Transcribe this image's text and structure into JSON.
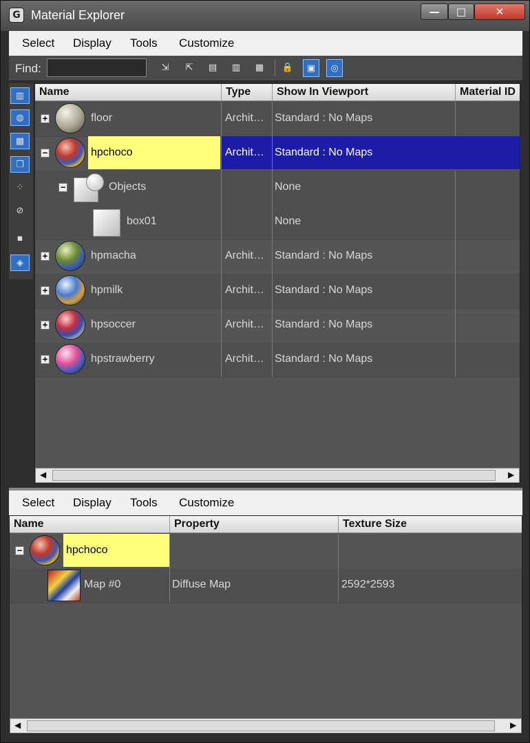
{
  "window": {
    "title": "Material Explorer",
    "icon": "app-logo-icon",
    "min": "—",
    "max": "□",
    "close": "✕"
  },
  "menu": [
    "Select",
    "Display",
    "Tools",
    "Customize"
  ],
  "find": {
    "label": "Find:",
    "value": ""
  },
  "materials_grid": {
    "columns": [
      "Name",
      "Type",
      "Show In Viewport",
      "Material ID"
    ],
    "rows": [
      {
        "name": "floor",
        "type": "Archit…",
        "viewport": "Standard : No Maps"
      },
      {
        "name": "hpchoco",
        "type": "Archit…",
        "viewport": "Standard : No Maps"
      },
      {
        "name": "Objects",
        "type": "",
        "viewport": "None"
      },
      {
        "name": "box01",
        "type": "",
        "viewport": "None"
      },
      {
        "name": "hpmacha",
        "type": "Archit…",
        "viewport": "Standard : No Maps"
      },
      {
        "name": "hpmilk",
        "type": "Archit…",
        "viewport": "Standard : No Maps"
      },
      {
        "name": "hpsoccer",
        "type": "Archit…",
        "viewport": "Standard : No Maps"
      },
      {
        "name": "hpstrawberry",
        "type": "Archit…",
        "viewport": "Standard : No Maps"
      }
    ]
  },
  "detail_menu": [
    "Select",
    "Display",
    "Tools",
    "Customize"
  ],
  "detail_grid": {
    "columns": [
      "Name",
      "Property",
      "Texture Size"
    ],
    "rows": [
      {
        "name": "hpchoco",
        "property": "",
        "texture": ""
      },
      {
        "name": "Map #0",
        "property": "Diffuse Map",
        "texture": "2592*2593"
      }
    ]
  },
  "colors": {
    "selection_yellow": "#ffff7a",
    "selection_blue": "#1c1ca8",
    "toolbar_active": "#2e6fc4"
  }
}
